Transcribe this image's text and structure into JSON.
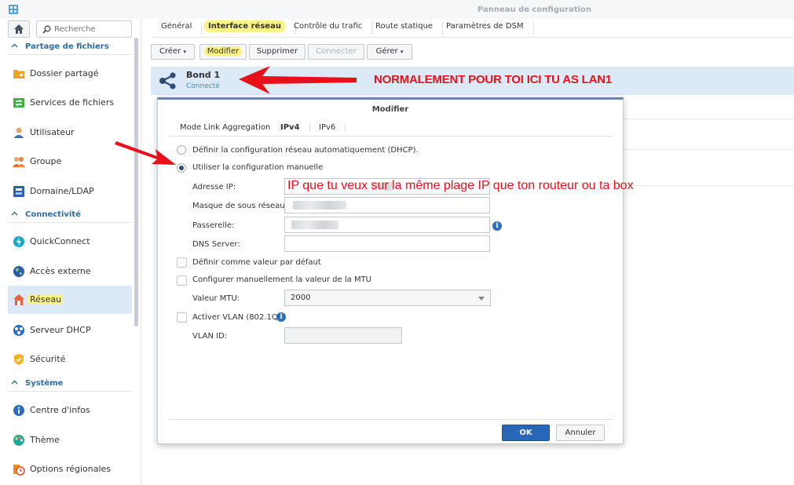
{
  "window": {
    "title": "Panneau de configuration"
  },
  "sidebar": {
    "search_placeholder": "Recherche",
    "sections": [
      {
        "label": "Partage de fichiers",
        "items": [
          {
            "label": "Dossier partagé",
            "icon": "folder-icon"
          },
          {
            "label": "Services de fichiers",
            "icon": "file-services-icon"
          },
          {
            "label": "Utilisateur",
            "icon": "user-icon"
          },
          {
            "label": "Groupe",
            "icon": "group-icon"
          },
          {
            "label": "Domaine/LDAP",
            "icon": "domain-icon"
          }
        ]
      },
      {
        "label": "Connectivité",
        "items": [
          {
            "label": "QuickConnect",
            "icon": "quickconnect-icon"
          },
          {
            "label": "Accès externe",
            "icon": "globe-icon"
          },
          {
            "label": "Réseau",
            "icon": "network-home-icon",
            "active": true
          },
          {
            "label": "Serveur DHCP",
            "icon": "dhcp-icon"
          },
          {
            "label": "Sécurité",
            "icon": "shield-icon"
          }
        ]
      },
      {
        "label": "Système",
        "items": [
          {
            "label": "Centre d'infos",
            "icon": "info-icon"
          },
          {
            "label": "Thème",
            "icon": "palette-icon"
          },
          {
            "label": "Options régionales",
            "icon": "clock-icon"
          }
        ]
      }
    ]
  },
  "tabs": [
    "Général",
    "Interface réseau",
    "Contrôle du trafic",
    "Route statique",
    "Paramètres de DSM"
  ],
  "toolbar": {
    "create": "Créer",
    "edit": "Modifier",
    "delete": "Supprimer",
    "connect": "Connecter",
    "manage": "Gérer"
  },
  "interface": {
    "name": "Bond 1",
    "status": "Connecté"
  },
  "annotations": {
    "lan_note": "NORMALEMENT POUR TOI ICI TU AS LAN1",
    "ip_note": "IP que tu veux sur la même plage IP que ton routeur ou ta box"
  },
  "dialog": {
    "title": "Modifier",
    "tabs": [
      "Mode Link Aggregation",
      "IPv4",
      "IPv6"
    ],
    "dhcp_option": "Définir la configuration réseau automatiquement (DHCP).",
    "manual_option": "Utiliser la configuration manuelle",
    "ip_label": "Adresse IP:",
    "mask_label": "Masque de sous réseau:",
    "gateway_label": "Passerelle:",
    "dns_label": "DNS Server:",
    "default_label": "Définir comme valeur par défaut",
    "mtu_manual_label": "Configurer manuellement la valeur de la MTU",
    "mtu_label": "Valeur MTU:",
    "mtu_value": "2000",
    "vlan_label": "Activer VLAN (802.1Q)",
    "vlan_id_label": "VLAN ID:",
    "ok": "OK",
    "cancel": "Annuler"
  },
  "colors": {
    "accent": "#2a66b8",
    "highlight": "#fbf28a",
    "annotation": "#e8101b",
    "selected_row": "#dce9f7"
  }
}
